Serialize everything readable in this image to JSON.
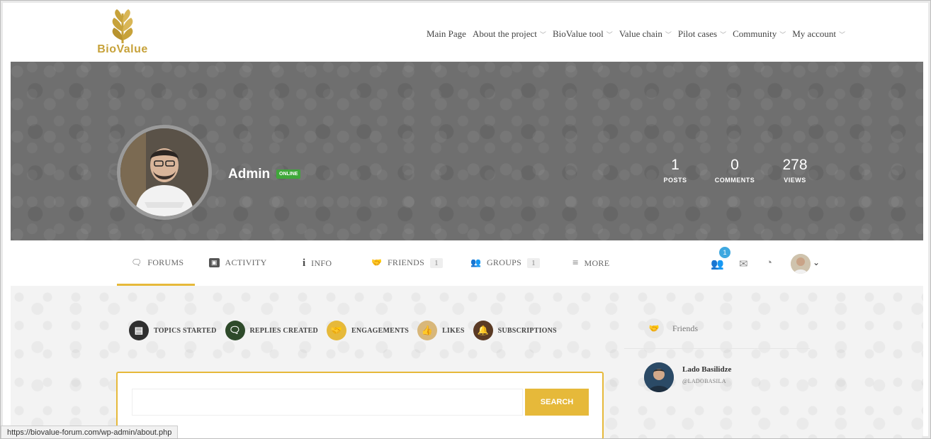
{
  "header": {
    "logo_text": "BioValue",
    "nav": [
      {
        "label": "Main Page",
        "dropdown": false
      },
      {
        "label": "About the project",
        "dropdown": true
      },
      {
        "label": "BioValue tool",
        "dropdown": true
      },
      {
        "label": "Value chain",
        "dropdown": true
      },
      {
        "label": "Pilot cases",
        "dropdown": true
      },
      {
        "label": "Community",
        "dropdown": true
      },
      {
        "label": "My account",
        "dropdown": true
      }
    ]
  },
  "profile": {
    "name": "Admin",
    "status_badge": "ONLINE",
    "stats": [
      {
        "value": "1",
        "label": "POSTS"
      },
      {
        "value": "0",
        "label": "COMMENTS"
      },
      {
        "value": "278",
        "label": "VIEWS"
      }
    ]
  },
  "profile_nav": {
    "tabs": [
      {
        "label": "FORUMS",
        "icon": "forums-icon",
        "count": null,
        "active": true
      },
      {
        "label": "ACTIVITY",
        "icon": "activity-icon",
        "count": null
      },
      {
        "label": "INFO",
        "icon": "info-icon",
        "count": null
      },
      {
        "label": "FRIENDS",
        "icon": "friends-icon",
        "count": "1"
      },
      {
        "label": "GROUPS",
        "icon": "groups-icon",
        "count": "1"
      },
      {
        "label": "MORE",
        "icon": "menu-icon",
        "count": null
      }
    ],
    "notification_count": "1"
  },
  "forum_subtabs": [
    {
      "label": "TOPICS STARTED",
      "icon": "topics-icon",
      "color": "#2f2f2f"
    },
    {
      "label": "REPLIES CREATED",
      "icon": "replies-icon",
      "color": "#2e4a2a"
    },
    {
      "label": "ENGAGEMENTS",
      "icon": "engagements-icon",
      "color": "#e6b93a"
    },
    {
      "label": "LIKES",
      "icon": "likes-icon",
      "color": "#d8b77a"
    },
    {
      "label": "SUBSCRIPTIONS",
      "icon": "bell-icon",
      "color": "#5a3a24"
    }
  ],
  "search": {
    "placeholder": "",
    "button_label": "SEARCH"
  },
  "friends_widget": {
    "title": "Friends",
    "friends": [
      {
        "name": "Lado Basilidze",
        "handle": "@LADOBASILA"
      }
    ]
  },
  "status_bar_url": "https://biovalue-forum.com/wp-admin/about.php",
  "colors": {
    "accent": "#e6b93a",
    "online": "#3fa83a",
    "cover": "#6f6f6f",
    "notification": "#3ea8e0"
  }
}
